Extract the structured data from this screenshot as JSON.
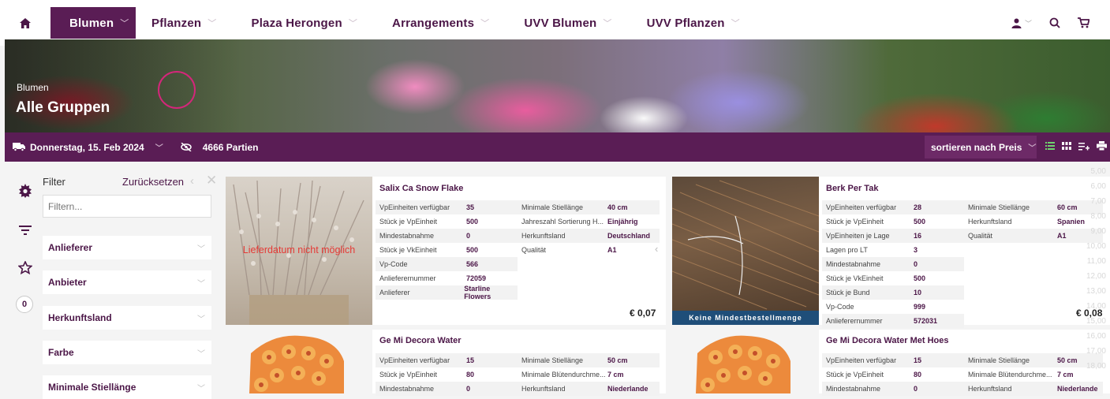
{
  "nav": {
    "items": [
      {
        "label": "Blumen",
        "active": true
      },
      {
        "label": "Pflanzen",
        "active": false
      },
      {
        "label": "Plaza Herongen",
        "active": false
      },
      {
        "label": "Arrangements",
        "active": false
      },
      {
        "label": "UVV Blumen",
        "active": false
      },
      {
        "label": "UVV Pflanzen",
        "active": false
      }
    ],
    "icons": [
      "home-icon",
      "user-icon",
      "search-icon",
      "cart-icon"
    ]
  },
  "hero": {
    "breadcrumb": "Blumen",
    "title": "Alle Gruppen"
  },
  "toolbar": {
    "date": "Donnerstag, 15. Feb 2024",
    "parties": "4666 Partien",
    "sort": "sortieren nach Preis"
  },
  "filter": {
    "title": "Filter",
    "reset": "Zurücksetzen",
    "placeholder": "Filtern...",
    "facets": [
      "Anlieferer",
      "Anbieter",
      "Herkunftsland",
      "Farbe",
      "Minimale Stiellänge"
    ],
    "favorites_count": "0"
  },
  "products": [
    {
      "name": "Salix Ca Snow Flake",
      "overlay": "Lieferdatum nicht möglich",
      "left": [
        [
          "VpEinheiten verfügbar",
          "35"
        ],
        [
          "Stück je VpEinheit",
          "500"
        ],
        [
          "Mindestabnahme",
          "0"
        ],
        [
          "Stück je VkEinheit",
          "500"
        ],
        [
          "Vp-Code",
          "566"
        ],
        [
          "Anlieferernummer",
          "72059"
        ],
        [
          "Anlieferer",
          "Starline Flowers"
        ]
      ],
      "right": [
        [
          "Minimale Stiellänge",
          "40 cm"
        ],
        [
          "Jahreszahl Sortierung H...",
          "Einjährig"
        ],
        [
          "Herkunftsland",
          "Deutschland"
        ],
        [
          "Qualität",
          "A1"
        ]
      ],
      "price": "€ 0,07"
    },
    {
      "name": "Berk Per Tak",
      "badge": "Keine Mindestbestellmenge",
      "left": [
        [
          "VpEinheiten verfügbar",
          "28"
        ],
        [
          "Stück je VpEinheit",
          "500"
        ],
        [
          "VpEinheiten je Lage",
          "16"
        ],
        [
          "Lagen pro LT",
          "3"
        ],
        [
          "Mindestabnahme",
          "0"
        ],
        [
          "Stück je VkEinheit",
          "500"
        ],
        [
          "Stück je Bund",
          "10"
        ],
        [
          "Vp-Code",
          "999"
        ],
        [
          "Anlieferernummer",
          "572031"
        ]
      ],
      "right": [
        [
          "Minimale Stiellänge",
          "60 cm"
        ],
        [
          "Herkunftsland",
          "Spanien"
        ],
        [
          "Qualität",
          "A1"
        ]
      ],
      "price": "€ 0,08"
    },
    {
      "name": "Ge Mi Decora Water",
      "left": [
        [
          "VpEinheiten verfügbar",
          "15"
        ],
        [
          "Stück je VpEinheit",
          "80"
        ],
        [
          "Mindestabnahme",
          "0"
        ]
      ],
      "right": [
        [
          "Minimale Stiellänge",
          "50 cm"
        ],
        [
          "Minimale Blütendurchme...",
          "7 cm"
        ],
        [
          "Herkunftsland",
          "Niederlande"
        ]
      ]
    },
    {
      "name": "Ge Mi Decora Water Met Hoes",
      "left": [
        [
          "VpEinheiten verfügbar",
          "15"
        ],
        [
          "Stück je VpEinheit",
          "80"
        ],
        [
          "Mindestabnahme",
          "0"
        ]
      ],
      "right": [
        [
          "Minimale Stiellänge",
          "50 cm"
        ],
        [
          "Minimale Blütendurchme...",
          "7 cm"
        ],
        [
          "Herkunftsland",
          "Niederlande"
        ]
      ]
    }
  ],
  "time_scale": [
    "5,00",
    "6,00",
    "7,00",
    "8,00",
    "9,00",
    "10,00",
    "11,00",
    "12,00",
    "13,00",
    "14,00",
    "15,00",
    "16,00",
    "17,00",
    "18,00"
  ],
  "colors": {
    "brand": "#5a1d55",
    "accent": "#4b1647",
    "warning": "#e53935",
    "badge": "#1f4e79"
  }
}
